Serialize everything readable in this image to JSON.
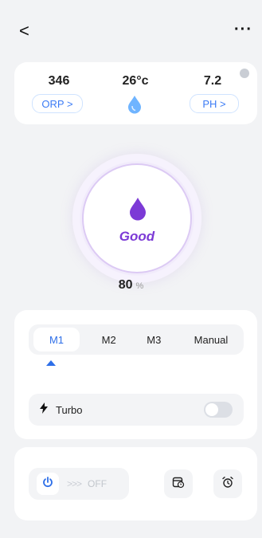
{
  "header": {
    "back_label": "<",
    "more_label": "···"
  },
  "stats": {
    "orp_value": "346",
    "orp_label": "ORP >",
    "temp_value": "26°c",
    "ph_value": "7.2",
    "ph_label": "PH >"
  },
  "status": {
    "quality_label": "Good",
    "percent_value": "80",
    "percent_unit": "%"
  },
  "modes": {
    "items": [
      "M1",
      "M2",
      "M3",
      "Manual"
    ],
    "active_index": 0
  },
  "turbo": {
    "label": "Turbo",
    "enabled": false
  },
  "power": {
    "state_label": "OFF",
    "chevrons": ">>>"
  },
  "colors": {
    "accent": "#2e6fe8",
    "purple": "#7c3ad6",
    "drop_blue": "#5aa6ff"
  },
  "icons": {
    "temp": "water-drop-icon",
    "status": "water-drop-purple-icon",
    "turbo": "lightning-icon",
    "power": "power-icon",
    "schedule": "calendar-clock-icon",
    "alarm": "alarm-clock-icon"
  }
}
